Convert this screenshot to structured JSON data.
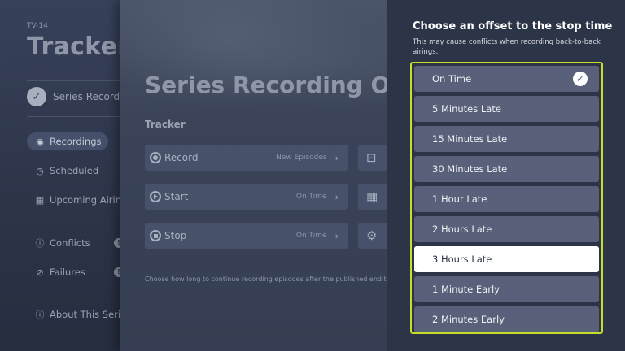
{
  "left_panel": {
    "rating": "TV-14",
    "title": "Tracker",
    "series_recording_label": "Series Record",
    "nav": [
      {
        "label": "Recordings",
        "icon": "record-dot-icon",
        "selected": true
      },
      {
        "label": "Scheduled",
        "icon": "clock-icon",
        "selected": false
      },
      {
        "label": "Upcoming Airings",
        "icon": "calendar-icon",
        "selected": false
      },
      {
        "label": "Conflicts",
        "icon": "alert-icon",
        "badge": "!",
        "selected": false
      },
      {
        "label": "Failures",
        "icon": "prohibited-icon",
        "badge": "!",
        "selected": false
      },
      {
        "label": "About This Series",
        "icon": "info-icon",
        "selected": false
      }
    ]
  },
  "middle_panel": {
    "title": "Series Recording Opti",
    "subtitle": "Tracker",
    "options": [
      {
        "label": "Record",
        "value": "New Episodes",
        "icon": "record-icon",
        "side_icon": "save-icon",
        "side_glyph": "⊟"
      },
      {
        "label": "Start",
        "value": "On Time",
        "icon": "play-icon",
        "side_icon": "grid-icon",
        "side_glyph": "▦"
      },
      {
        "label": "Stop",
        "value": "On Time",
        "icon": "stop-icon",
        "side_icon": "gear-icon",
        "side_glyph": "⚙"
      }
    ],
    "hint": "Choose how long to continue recording episodes after the published end ti"
  },
  "right_panel": {
    "title": "Choose an offset to the stop time",
    "description": "This may cause conflicts when recording back-to-back airings.",
    "accent_color": "#c8dd2a",
    "options": [
      {
        "label": "On Time",
        "checked": true,
        "focused": false
      },
      {
        "label": "5 Minutes Late",
        "checked": false,
        "focused": false
      },
      {
        "label": "15 Minutes Late",
        "checked": false,
        "focused": false
      },
      {
        "label": "30 Minutes Late",
        "checked": false,
        "focused": false
      },
      {
        "label": "1 Hour Late",
        "checked": false,
        "focused": false
      },
      {
        "label": "2 Hours Late",
        "checked": false,
        "focused": false
      },
      {
        "label": "3 Hours Late",
        "checked": false,
        "focused": true
      },
      {
        "label": "1 Minute Early",
        "checked": false,
        "focused": false
      },
      {
        "label": "2 Minutes Early",
        "checked": false,
        "focused": false
      }
    ]
  }
}
